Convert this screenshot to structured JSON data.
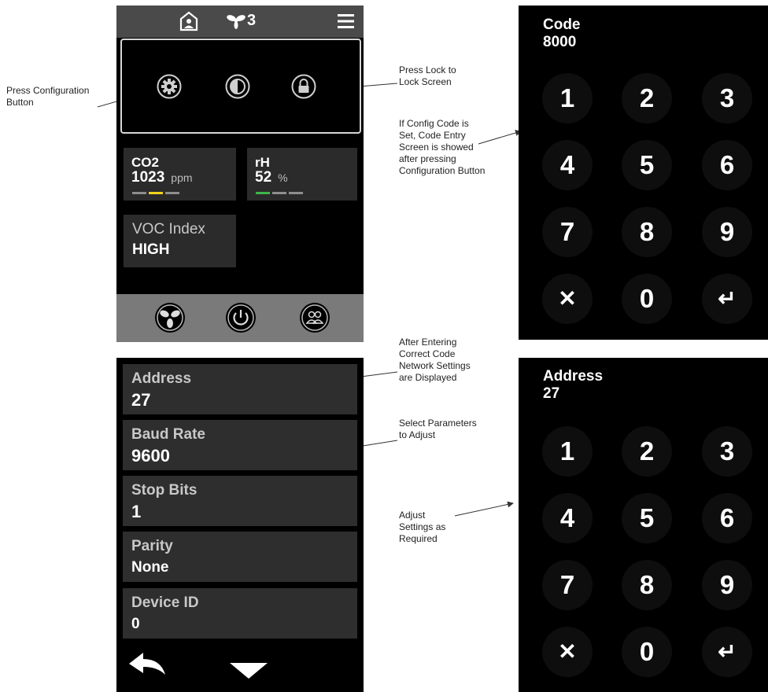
{
  "main_screen": {
    "zone_number": "3",
    "co2": {
      "label": "CO2",
      "value": "1023",
      "unit": "ppm"
    },
    "rh": {
      "label": "rH",
      "value": "52",
      "unit": "%"
    },
    "voc": {
      "label": "VOC Index",
      "value": "HIGH"
    },
    "colors": {
      "co2_indicator": "#f2d21a",
      "rh_indicator": "#3db54a",
      "inactive_bar": "#8e8e8e"
    }
  },
  "code_screen": {
    "title": "Code",
    "value": "8000",
    "keys": [
      "1",
      "2",
      "3",
      "4",
      "5",
      "6",
      "7",
      "8",
      "9",
      "✕",
      "0",
      "↵"
    ]
  },
  "network_screen": {
    "items": [
      {
        "label": "Address",
        "value": "27"
      },
      {
        "label": "Baud Rate",
        "value": "9600"
      },
      {
        "label": "Stop Bits",
        "value": "1"
      },
      {
        "label": "Parity",
        "value": "None"
      },
      {
        "label": "Device ID",
        "value": "0"
      }
    ]
  },
  "address_screen": {
    "title": "Address",
    "value": "27",
    "keys": [
      "1",
      "2",
      "3",
      "4",
      "5",
      "6",
      "7",
      "8",
      "9",
      "✕",
      "0",
      "↵"
    ]
  },
  "annotations": {
    "press_config": "Press Configuration Button",
    "press_lock": "Press Lock to Lock Screen",
    "config_code": "If Config Code is Set, Code Entry Screen is showed after pressing Configuration Button",
    "after_code": "After Entering Correct Code Network Settings are Displayed",
    "select_params": "Select Parameters to Adjust",
    "adjust": "Adjust Settings as Required"
  }
}
